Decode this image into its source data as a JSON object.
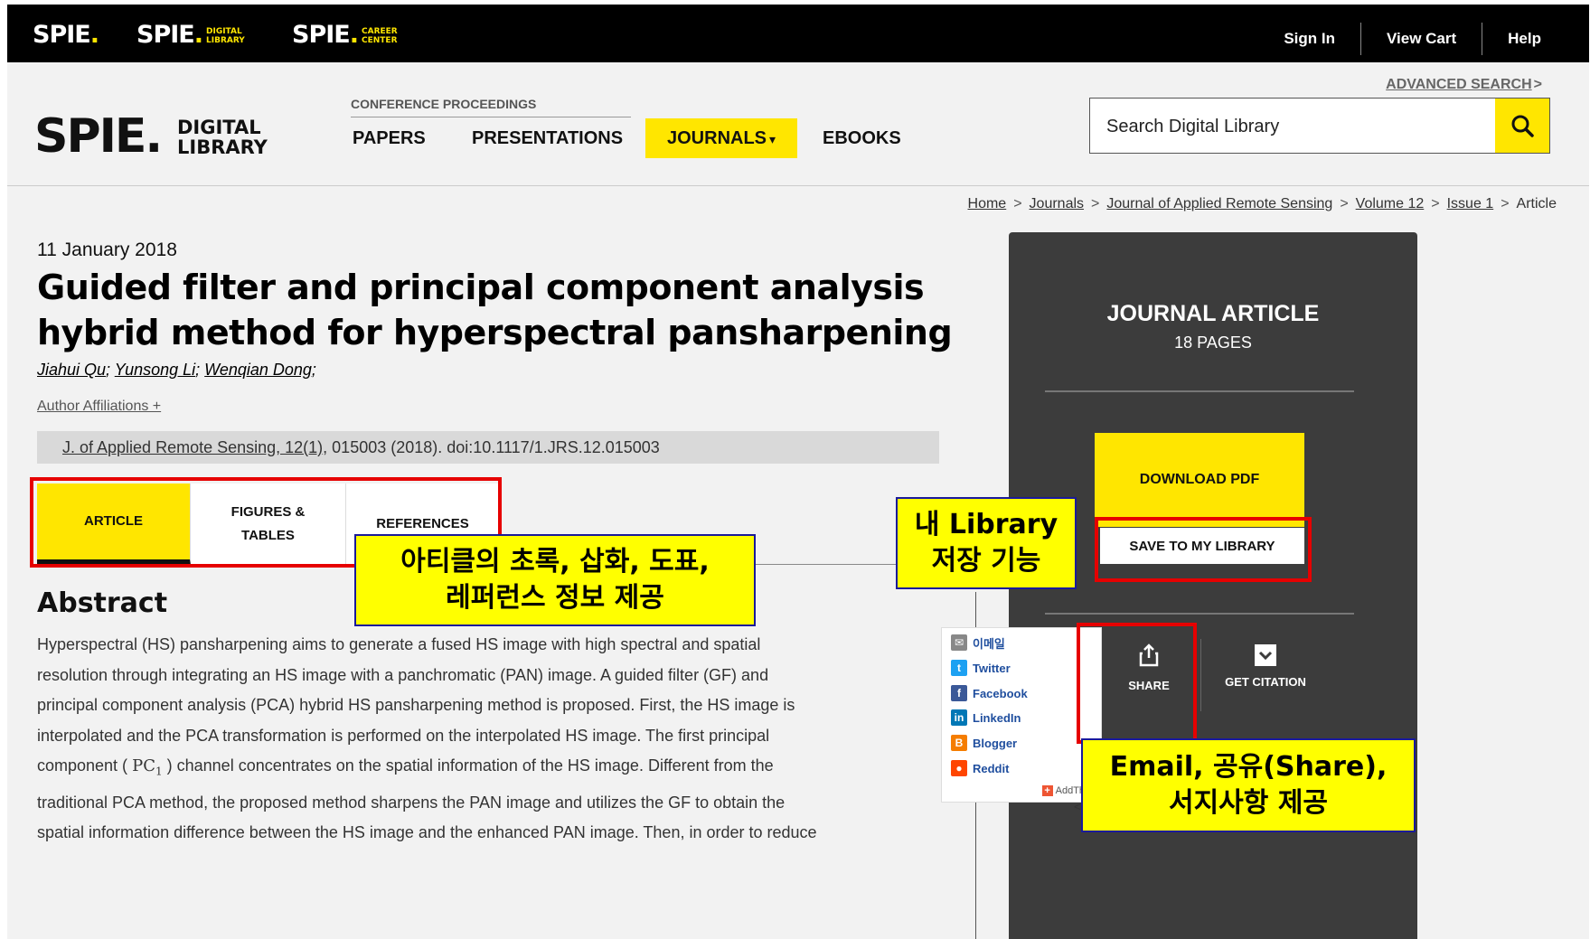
{
  "topbar": {
    "brands": [
      {
        "name": "SPIE",
        "sub1": "",
        "sub2": ""
      },
      {
        "name": "SPIE",
        "sub1": "DIGITAL",
        "sub2": "LIBRARY"
      },
      {
        "name": "SPIE",
        "sub1": "CAREER",
        "sub2": "CENTER"
      }
    ],
    "links": [
      "Sign In",
      "View Cart",
      "Help"
    ]
  },
  "header": {
    "advanced_search": "ADVANCED SEARCH",
    "advanced_arrow": ">",
    "logo_main": "SPIE.",
    "logo_line1": "DIGITAL",
    "logo_line2": "LIBRARY",
    "conference_proceedings": "CONFERENCE PROCEEDINGS",
    "nav": [
      "PAPERS",
      "PRESENTATIONS",
      "JOURNALS",
      "EBOOKS"
    ],
    "journals_caret": "▾",
    "search_placeholder": "Search Digital Library"
  },
  "breadcrumb": {
    "items": [
      "Home",
      "Journals",
      "Journal of Applied Remote Sensing",
      "Volume 12",
      "Issue 1"
    ],
    "current": "Article",
    "separator": ">"
  },
  "article": {
    "date": "11 January 2018",
    "title": "Guided filter and principal component analysis hybrid method for hyperspectral pansharpening",
    "authors": [
      "Jiahui Qu",
      "Yunsong Li",
      "Wenqian Dong"
    ],
    "affiliations": "Author Affiliations +",
    "citation_link": "J. of Applied Remote Sensing, 12(1)",
    "citation_rest": ", 015003 (2018). doi:10.1117/1.JRS.12.015003",
    "tabs": [
      {
        "line1": "ARTICLE",
        "line2": ""
      },
      {
        "line1": "FIGURES &",
        "line2": "TABLES"
      },
      {
        "line1": "REFERENCES",
        "line2": ""
      }
    ],
    "abstract_heading": "Abstract",
    "abstract_lines": [
      "Hyperspectral (HS) pansharpening aims to generate a fused HS image with high spectral and spatial",
      "resolution through integrating an HS image with a panchromatic (PAN) image. A guided filter (GF) and",
      "principal component analysis (PCA) hybrid HS pansharpening method is proposed. First, the HS image is",
      "interpolated and the PCA transformation is performed on the interpolated HS image. The first principal",
      "channel concentrates on the spatial information of the HS image. Different from the",
      "traditional PCA method, the proposed method sharpens the PAN image and utilizes the GF to obtain the",
      "spatial information difference between the HS image and the enhanced PAN image. Then, in order to reduce"
    ],
    "pc_symbol": "PC",
    "pc_subscript": "1",
    "component_prefix": "component (",
    "component_suffix": ")"
  },
  "side_panel": {
    "type": "JOURNAL ARTICLE",
    "pages": "18 PAGES",
    "download": "DOWNLOAD PDF",
    "save": "SAVE TO MY LIBRARY",
    "share": "SHARE",
    "get_citation": "GET CITATION"
  },
  "share_menu": {
    "items": [
      "이메일",
      "Twitter",
      "Facebook",
      "LinkedIn",
      "Blogger",
      "Reddit"
    ],
    "addthis": "AddThis",
    "more_arrow": "<"
  },
  "annotations": {
    "tabs_note_line1": "아티클의 초록, 삽화, 도표,",
    "tabs_note_line2": "레퍼런스 정보 제공",
    "library_note_line1": "내 Library",
    "library_note_line2": "저장 기능",
    "share_note_line1": "Email, 공유(Share),",
    "share_note_line2": "서지사항 제공"
  },
  "colors": {
    "accent": "#ffe600",
    "highlight_box": "#e60000",
    "note_fill": "#ffff00",
    "panel": "#3c3c3c"
  }
}
